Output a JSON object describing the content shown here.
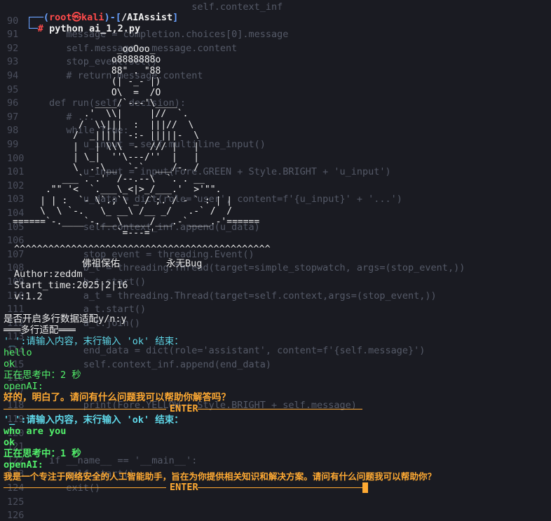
{
  "background_code": [
    {
      "num": "",
      "text": "                         self.context_inf"
    },
    {
      "num": "90",
      "text": ""
    },
    {
      "num": "91",
      "text": "   message = completion.choices[0].message"
    },
    {
      "num": "92",
      "text": "   self.message = message.content"
    },
    {
      "num": "93",
      "text": "   stop_event.set()"
    },
    {
      "num": "94",
      "text": "   # return message.content"
    },
    {
      "num": "95",
      "text": ""
    },
    {
      "num": "96",
      "text": "def run(self, decision):"
    },
    {
      "num": "97",
      "text": "   # ..."
    },
    {
      "num": "98",
      "text": "   while True:"
    },
    {
      "num": "99",
      "text": "      u_input = self.multiline_input()"
    },
    {
      "num": "100",
      "text": ""
    },
    {
      "num": "101",
      "text": "      u_input = input(Fore.GREEN + Style.BRIGHT + 'u_input')"
    },
    {
      "num": "102",
      "text": ""
    },
    {
      "num": "103",
      "text": "      u_data = dict(role='user', content=f'{u_input}' + '...')"
    },
    {
      "num": "104",
      "text": ""
    },
    {
      "num": "105",
      "text": "      self.context_inf.append(u_data)"
    },
    {
      "num": "106",
      "text": ""
    },
    {
      "num": "107",
      "text": "      stop_event = threading.Event()"
    },
    {
      "num": "108",
      "text": "      b_t = threading.Thread(target=simple_stopwatch, args=(stop_event,))"
    },
    {
      "num": "109",
      "text": "      b_t.start()"
    },
    {
      "num": "110",
      "text": "      a_t = threading.Thread(target=self.context,args=(stop_event,))"
    },
    {
      "num": "111",
      "text": "      a_t.start()"
    },
    {
      "num": "112",
      "text": "      a_t.join()"
    },
    {
      "num": "113",
      "text": ""
    },
    {
      "num": "114",
      "text": "      end_data = dict(role='assistant', content=f'{self.message}')"
    },
    {
      "num": "115",
      "text": "      self.context_inf.append(end_data)"
    },
    {
      "num": "116",
      "text": ""
    },
    {
      "num": "117",
      "text": ""
    },
    {
      "num": "118",
      "text": "      print(Fore.YELLOW + Style.BRIGHT + self.message)"
    },
    {
      "num": "119",
      "text": ""
    },
    {
      "num": "120",
      "text": ""
    },
    {
      "num": "121",
      "text": ""
    },
    {
      "num": "122",
      "text": "if __name__ == '__main__':"
    },
    {
      "num": "123",
      "text": "   self.start()"
    },
    {
      "num": "124",
      "text": "   exit()"
    },
    {
      "num": "125",
      "text": ""
    },
    {
      "num": "126",
      "text": ""
    }
  ],
  "prompt": {
    "corner_top": "┌──(",
    "user": "root",
    "skull": "㉿",
    "host": "kali",
    "path_open": ")-[",
    "path": "/AIAssist",
    "path_close": "]",
    "corner_bottom": "└─",
    "hash": "#",
    "command": "python ai_1,2.py"
  },
  "banner": {
    "ascii_lines": [
      "                   _ooOoo_",
      "                  o8888888o",
      "                  88\" . \"88",
      "                  (| -_- |)",
      "                  O\\  =  /O",
      "               ____/`---'\\____",
      "             .'  \\\\|     |//  `.",
      "            /  \\\\|||  :  |||//  \\",
      "           /  _||||| -:- |||||-  \\",
      "           |   | \\\\\\  -  /// |   |",
      "           | \\_|  ''\\---/''  |   |",
      "           \\  .-\\__  `-`  ___/-. /",
      "         ___`. .'  /--.--\\  `. . __",
      "      .\"\" '<  `.___\\_<|>_/___.'  >'\"\".",
      "     | | :  `- \\`.;`\\ _ /`;.`/ - ` : | |",
      "     \\  \\ `-.   \\_ __\\ /__ _/   .-` /  /",
      "======`-.____`-.___\\_____/___.-`____.-'======",
      "                   `=---='"
    ],
    "carets": "^^^^^^^^^^^^^^^^^^^^^^^^^^^^^^^^^^^^^^^^^^^^^",
    "blessing_left": "佛祖保佑",
    "blessing_right": "永无Bug",
    "author": "Author:zeddm",
    "start_time": "Start_time:2025|2|16",
    "version": "v:1.2"
  },
  "session": {
    "multiline_question": "是否开启多行数据适配y/n:y",
    "multiline_header": "═══多行适配═══",
    "input_prompt_1": "'_':请输入内容，末行输入 'ok' 结束：",
    "user_lines_1": [
      "hello",
      "ok"
    ],
    "thinking_1": "正在思考中：2 秒",
    "ai_label_1": "openAI:",
    "ai_reply_1": "好的，明白了。请问有什么问题我可以帮助你解答吗？",
    "divider_label": "ENTER",
    "input_prompt_2": "'_':请输入内容，末行输入 'ok' 结束：",
    "user_lines_2": [
      "who are you",
      "ok"
    ],
    "thinking_2": "正在思考中：1 秒",
    "ai_label_2": "openAI:",
    "ai_reply_2": "我是一个专注于网络安全的人工智能助手，旨在为你提供相关知识和解决方案。请问有什么问题我可以帮助你？",
    "divider_label_2": "ENTER"
  },
  "colors": {
    "background": "#1a1b22",
    "cyan": "#5fd7e8",
    "green": "#52f06b",
    "orange": "#ffaa33",
    "prompt_blue": "#6aa2ff",
    "prompt_red": "#ff4b4b"
  }
}
